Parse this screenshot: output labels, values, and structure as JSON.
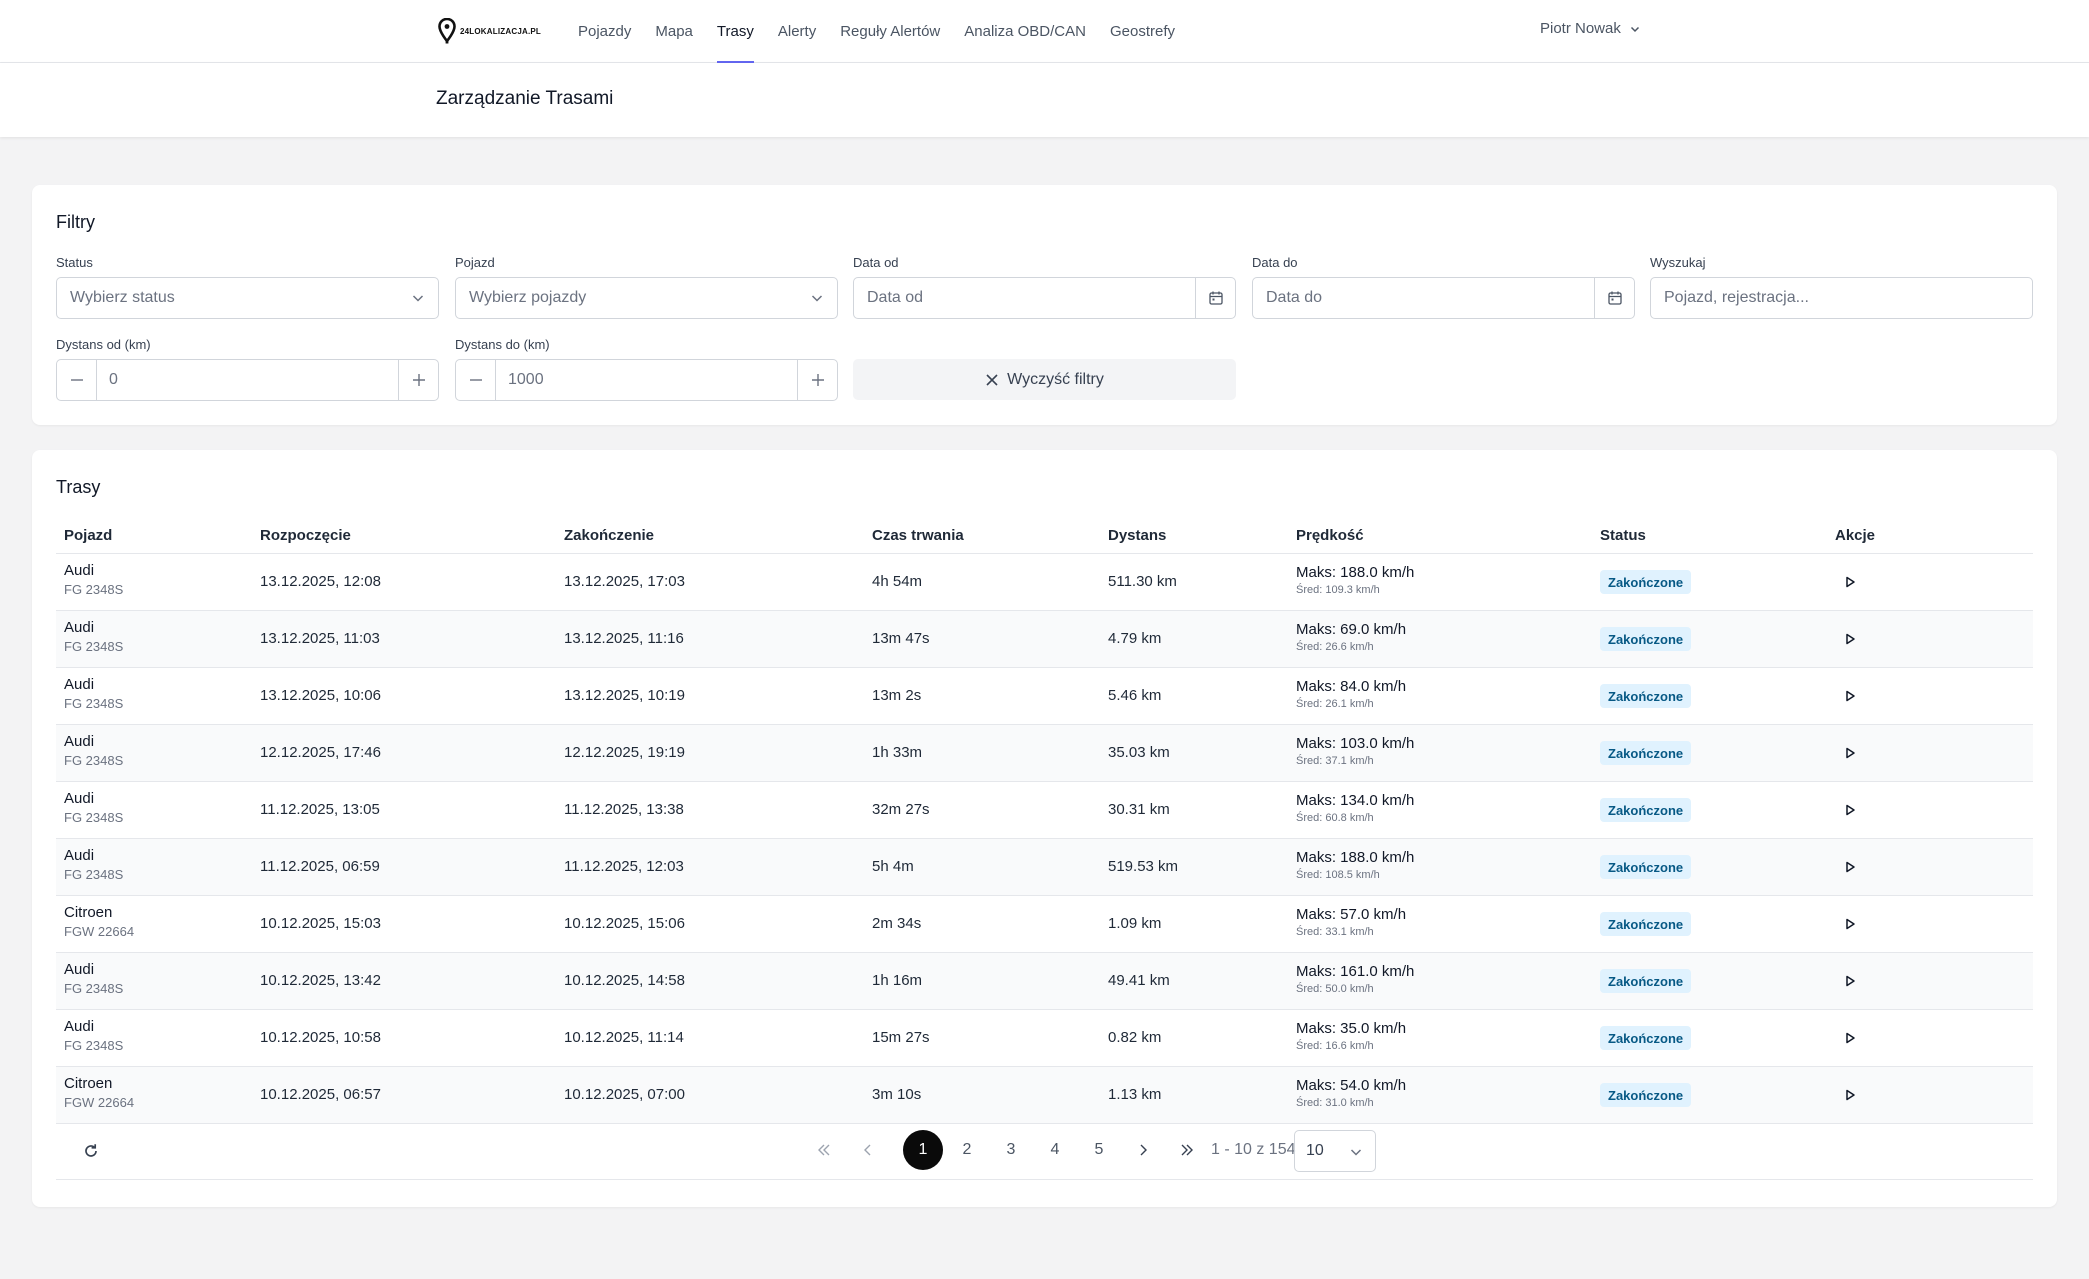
{
  "brand": {
    "logo_text": "24LOKALIZACJA.PL"
  },
  "nav": {
    "items": [
      {
        "label": "Pojazdy",
        "active": false
      },
      {
        "label": "Mapa",
        "active": false
      },
      {
        "label": "Trasy",
        "active": true
      },
      {
        "label": "Alerty",
        "active": false
      },
      {
        "label": "Reguły Alertów",
        "active": false
      },
      {
        "label": "Analiza OBD/CAN",
        "active": false
      },
      {
        "label": "Geostrefy",
        "active": false
      }
    ],
    "user_name": "Piotr Nowak"
  },
  "page": {
    "title": "Zarządzanie Trasami"
  },
  "filters": {
    "title": "Filtry",
    "status": {
      "label": "Status",
      "placeholder": "Wybierz status"
    },
    "vehicle": {
      "label": "Pojazd",
      "placeholder": "Wybierz pojazdy"
    },
    "date_from": {
      "label": "Data od",
      "placeholder": "Data od"
    },
    "date_to": {
      "label": "Data do",
      "placeholder": "Data do"
    },
    "search": {
      "label": "Wyszukaj",
      "placeholder": "Pojazd, rejestracja..."
    },
    "distance_from": {
      "label": "Dystans od (km)",
      "value": "0"
    },
    "distance_to": {
      "label": "Dystans do (km)",
      "value": "1000"
    },
    "clear_label": "Wyczyść filtry"
  },
  "routes": {
    "title": "Trasy",
    "columns": {
      "vehicle": "Pojazd",
      "start": "Rozpoczęcie",
      "end": "Zakończenie",
      "duration": "Czas trwania",
      "distance": "Dystans",
      "speed": "Prędkość",
      "status": "Status",
      "actions": "Akcje"
    },
    "rows": [
      {
        "vehicle": "Audi",
        "reg": "FG 2348S",
        "start": "13.12.2025, 12:08",
        "end": "13.12.2025, 17:03",
        "duration": "4h 54m",
        "distance": "511.30 km",
        "max": "Maks: 188.0 km/h",
        "avg": "Śred: 109.3 km/h",
        "status": "Zakończone"
      },
      {
        "vehicle": "Audi",
        "reg": "FG 2348S",
        "start": "13.12.2025, 11:03",
        "end": "13.12.2025, 11:16",
        "duration": "13m 47s",
        "distance": "4.79 km",
        "max": "Maks: 69.0 km/h",
        "avg": "Śred: 26.6 km/h",
        "status": "Zakończone"
      },
      {
        "vehicle": "Audi",
        "reg": "FG 2348S",
        "start": "13.12.2025, 10:06",
        "end": "13.12.2025, 10:19",
        "duration": "13m 2s",
        "distance": "5.46 km",
        "max": "Maks: 84.0 km/h",
        "avg": "Śred: 26.1 km/h",
        "status": "Zakończone"
      },
      {
        "vehicle": "Audi",
        "reg": "FG 2348S",
        "start": "12.12.2025, 17:46",
        "end": "12.12.2025, 19:19",
        "duration": "1h 33m",
        "distance": "35.03 km",
        "max": "Maks: 103.0 km/h",
        "avg": "Śred: 37.1 km/h",
        "status": "Zakończone"
      },
      {
        "vehicle": "Audi",
        "reg": "FG 2348S",
        "start": "11.12.2025, 13:05",
        "end": "11.12.2025, 13:38",
        "duration": "32m 27s",
        "distance": "30.31 km",
        "max": "Maks: 134.0 km/h",
        "avg": "Śred: 60.8 km/h",
        "status": "Zakończone"
      },
      {
        "vehicle": "Audi",
        "reg": "FG 2348S",
        "start": "11.12.2025, 06:59",
        "end": "11.12.2025, 12:03",
        "duration": "5h 4m",
        "distance": "519.53 km",
        "max": "Maks: 188.0 km/h",
        "avg": "Śred: 108.5 km/h",
        "status": "Zakończone"
      },
      {
        "vehicle": "Citroen",
        "reg": "FGW 22664",
        "start": "10.12.2025, 15:03",
        "end": "10.12.2025, 15:06",
        "duration": "2m 34s",
        "distance": "1.09 km",
        "max": "Maks: 57.0 km/h",
        "avg": "Śred: 33.1 km/h",
        "status": "Zakończone"
      },
      {
        "vehicle": "Audi",
        "reg": "FG 2348S",
        "start": "10.12.2025, 13:42",
        "end": "10.12.2025, 14:58",
        "duration": "1h 16m",
        "distance": "49.41 km",
        "max": "Maks: 161.0 km/h",
        "avg": "Śred: 50.0 km/h",
        "status": "Zakończone"
      },
      {
        "vehicle": "Audi",
        "reg": "FG 2348S",
        "start": "10.12.2025, 10:58",
        "end": "10.12.2025, 11:14",
        "duration": "15m 27s",
        "distance": "0.82 km",
        "max": "Maks: 35.0 km/h",
        "avg": "Śred: 16.6 km/h",
        "status": "Zakończone"
      },
      {
        "vehicle": "Citroen",
        "reg": "FGW 22664",
        "start": "10.12.2025, 06:57",
        "end": "10.12.2025, 07:00",
        "duration": "3m 10s",
        "distance": "1.13 km",
        "max": "Maks: 54.0 km/h",
        "avg": "Śred: 31.0 km/h",
        "status": "Zakończone"
      }
    ]
  },
  "pagination": {
    "pages": [
      "1",
      "2",
      "3",
      "4",
      "5"
    ],
    "current": "1",
    "info": "1 - 10 z 154",
    "page_size": "10"
  },
  "colors": {
    "accent": "#6366f1",
    "badge_bg": "#e0f2fe",
    "badge_text": "#075985",
    "current_page": "#0a0a0a"
  },
  "icons": {
    "logo": "map-pin-icon",
    "user_menu": "chevron-down-icon",
    "select": "chevron-down-icon",
    "date": "calendar-icon",
    "stepper_minus": "minus-icon",
    "stepper_plus": "plus-icon",
    "clear": "close-icon",
    "row_action": "play-icon",
    "refresh": "refresh-icon",
    "first": "chevrons-left-icon",
    "prev": "chevron-left-icon",
    "next": "chevron-right-icon",
    "last": "chevrons-right-icon"
  }
}
